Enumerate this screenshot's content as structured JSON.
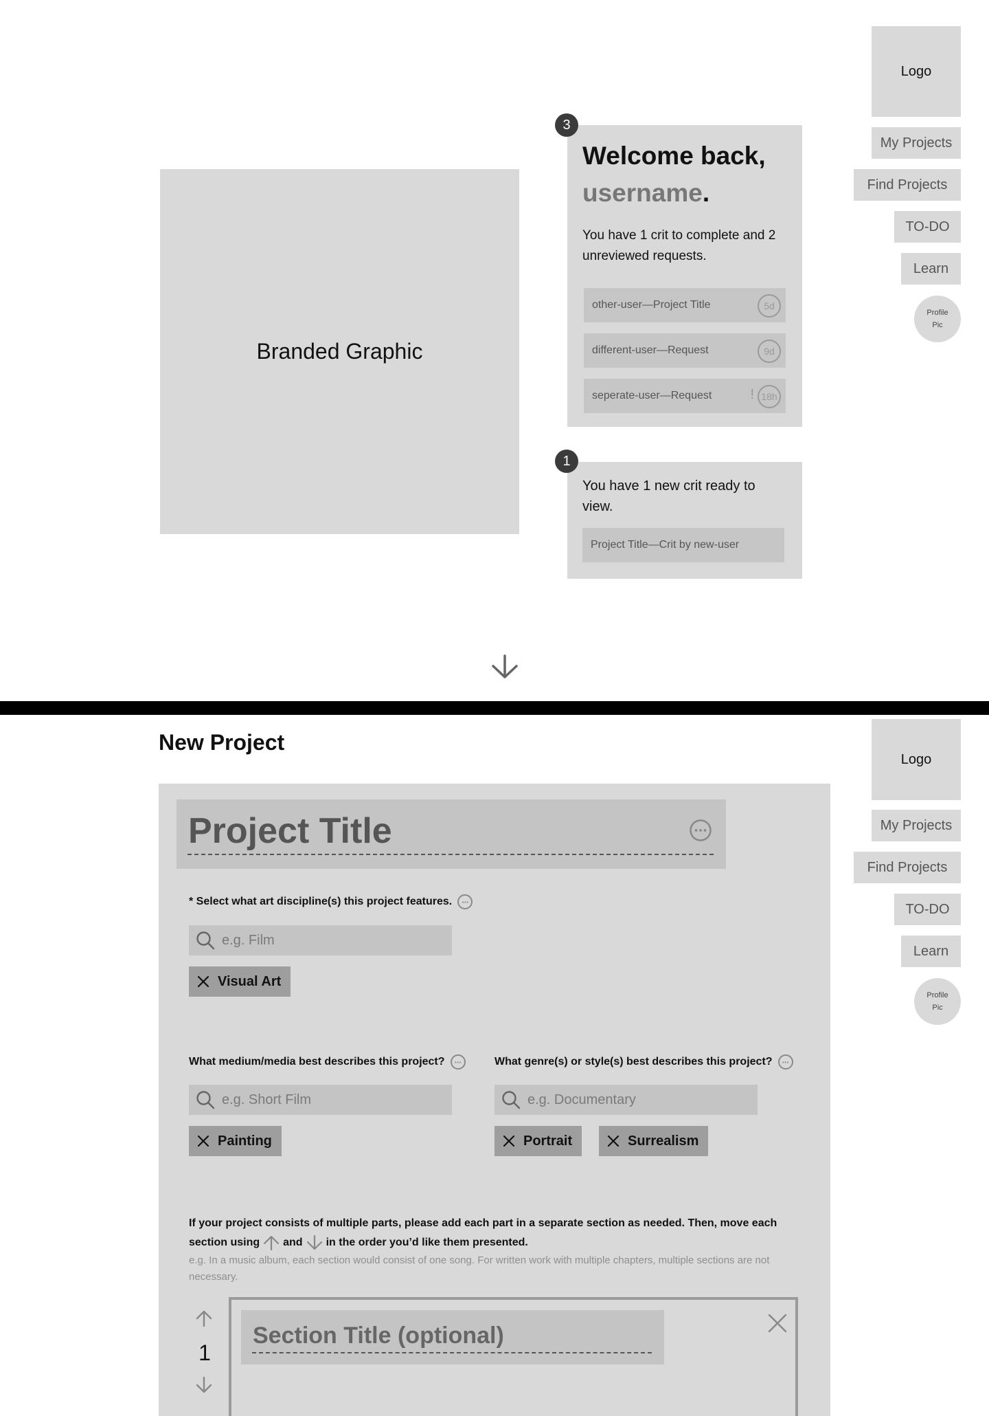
{
  "nav": {
    "logo": "Logo",
    "items": [
      "My Projects",
      "Find Projects",
      "TO-DO",
      "Learn"
    ],
    "avatar": "Profile Pic"
  },
  "dashboard": {
    "graphic_label": "Branded Graphic",
    "todo_card": {
      "badge": "3",
      "welcome": "Welcome back,",
      "username": "username",
      "period": ".",
      "summary": "You have 1 crit to complete and 2 unreviewed requests.",
      "items": [
        {
          "label": "other-user—Project Title",
          "time": "5d",
          "urgent": false
        },
        {
          "label": "different-user—Request",
          "time": "9d",
          "urgent": false
        },
        {
          "label": "seperate-user—Request",
          "time": "18h",
          "urgent": true
        }
      ]
    },
    "crit_card": {
      "badge": "1",
      "summary": "You have 1 new crit ready to view.",
      "item": "Project Title—Crit by new-user"
    }
  },
  "new_project": {
    "heading": "New Project",
    "title_placeholder": "Project Title",
    "discipline": {
      "label": "* Select what art discipline(s) this project features.",
      "placeholder": "e.g. Film",
      "chips": [
        "Visual Art"
      ]
    },
    "medium": {
      "label": "What medium/media best describes this project?",
      "placeholder": "e.g. Short Film",
      "chips": [
        "Painting"
      ]
    },
    "genre": {
      "label": "What genre(s) or style(s) best describes this project?",
      "placeholder": "e.g. Documentary",
      "chips": [
        "Portrait",
        "Surrealism"
      ]
    },
    "sections_info": {
      "line1": "If your project consists of multiple parts, please add each part in a separate section as needed. Then, move each",
      "line2_a": "section using",
      "line2_b": "and",
      "line2_c": "in the order you’d like them presented.",
      "hint": "e.g. In a music album, each section would consist of one song. For written work with multiple chapters, multiple sections are not necessary."
    },
    "section": {
      "number": "1",
      "title_placeholder": "Section Title (optional)"
    }
  },
  "colors": {
    "panel": "#d9d9d9",
    "field": "#c4c4c4",
    "chip": "#9e9e9e",
    "badge": "#3b3b3b",
    "divider": "#000000"
  }
}
